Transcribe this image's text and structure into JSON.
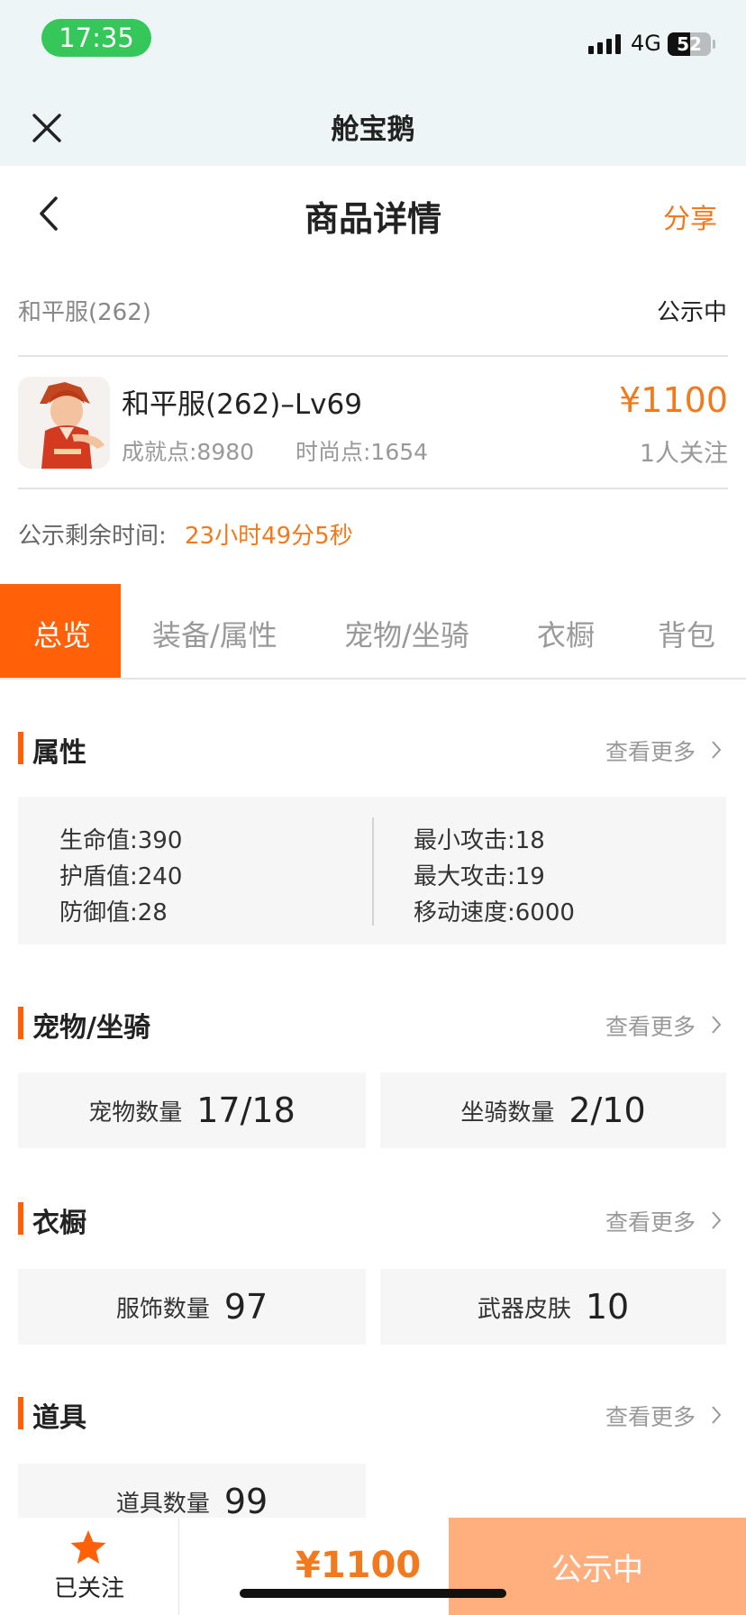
{
  "status": {
    "time": "17:35",
    "network": "4G",
    "battery": "52",
    "battery_level": 0.52
  },
  "app": {
    "title": "舱宝鹅"
  },
  "nav": {
    "title": "商品详情",
    "share": "分享"
  },
  "listing": {
    "server": "和平服(262)",
    "state": "公示中",
    "name": "和平服(262)–Lv69",
    "achievement": "成就点:8980",
    "fashion": "时尚点:1654",
    "price": "¥1100",
    "watchers": "1人关注",
    "remain_label": "公示剩余时间:",
    "remain_value": "23小时49分5秒"
  },
  "tabs": [
    {
      "label": "总览",
      "active": true
    },
    {
      "label": "装备/属性",
      "active": false
    },
    {
      "label": "宠物/坐骑",
      "active": false
    },
    {
      "label": "衣橱",
      "active": false
    },
    {
      "label": "背包",
      "active": false
    }
  ],
  "sections": {
    "attributes": {
      "title": "属性",
      "more": "查看更多",
      "left": [
        "生命值:390",
        "护盾值:240",
        "防御值:28"
      ],
      "right": [
        "最小攻击:18",
        "最大攻击:19",
        "移动速度:6000"
      ]
    },
    "pets": {
      "title": "宠物/坐骑",
      "more": "查看更多",
      "cards": [
        {
          "label": "宠物数量",
          "value": "17/18"
        },
        {
          "label": "坐骑数量",
          "value": "2/10"
        }
      ]
    },
    "wardrobe": {
      "title": "衣橱",
      "more": "查看更多",
      "cards": [
        {
          "label": "服饰数量",
          "value": "97"
        },
        {
          "label": "武器皮肤",
          "value": "10"
        }
      ]
    },
    "items": {
      "title": "道具",
      "more": "查看更多",
      "cards": [
        {
          "label": "道具数量",
          "value": "99"
        }
      ]
    }
  },
  "bottom": {
    "follow": "已关注",
    "price": "¥1100",
    "action": "公示中"
  },
  "colors": {
    "accent": "#ff6008",
    "price": "#f07a1d",
    "action_bg": "#ffae7e"
  },
  "icons": [
    "close-icon",
    "back-icon",
    "chevron-right-icon",
    "star-icon"
  ]
}
